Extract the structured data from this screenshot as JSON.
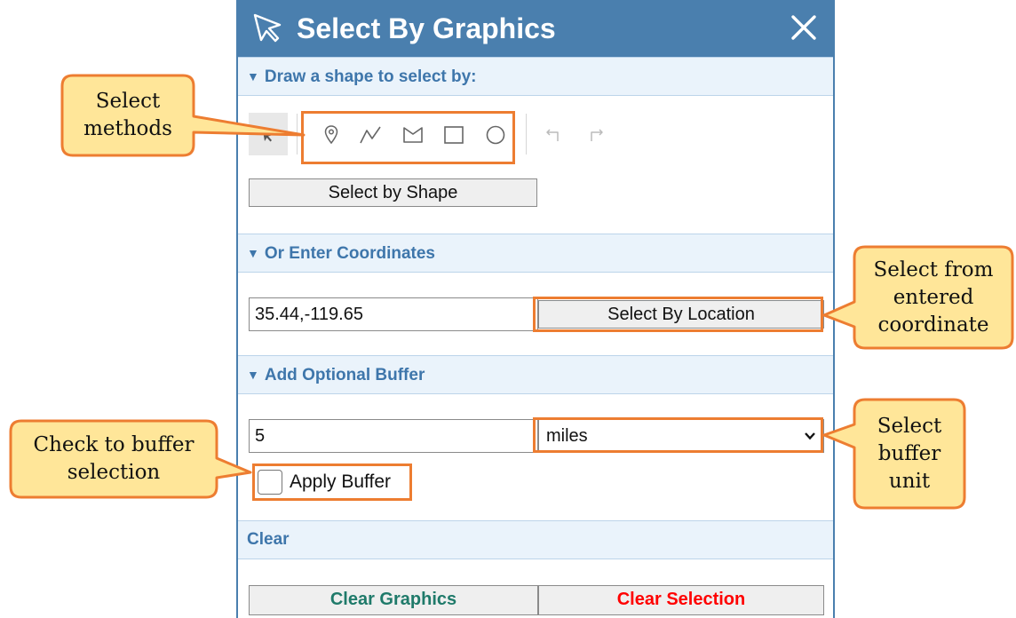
{
  "panel": {
    "title": "Select By Graphics",
    "sections": {
      "draw": "Draw a shape to select by:",
      "coordinates": "Or Enter Coordinates",
      "buffer": "Add Optional Buffer",
      "clear": "Clear"
    },
    "tools": [
      "pointer-icon",
      "point-icon",
      "polyline-icon",
      "polygon-icon",
      "rectangle-icon",
      "circle-icon",
      "undo-icon",
      "redo-icon"
    ],
    "select_by_shape_label": "Select by Shape",
    "coordinates_value": "35.44,-119.65",
    "select_by_location_label": "Select By Location",
    "buffer_value": "5",
    "buffer_unit": "miles",
    "apply_buffer_label": "Apply Buffer",
    "apply_buffer_checked": false,
    "clear_graphics_label": "Clear Graphics",
    "clear_selection_label": "Clear Selection"
  },
  "callouts": {
    "select_methods": [
      "Select",
      "methods"
    ],
    "select_from_coordinate": [
      "Select from",
      "entered",
      "coordinate"
    ],
    "select_buffer_unit": [
      "Select",
      "buffer",
      "unit"
    ],
    "check_to_buffer": [
      "Check to buffer",
      "selection"
    ]
  },
  "colors": {
    "titlebar": "#4a7fae",
    "section_text": "#3e76ab",
    "section_bg": "#eaf3fb",
    "highlight": "#ed7d31",
    "callout_fill": "#ffe699",
    "clear_graphics_text": "#1f7a6a",
    "clear_selection_text": "#ff0000"
  }
}
